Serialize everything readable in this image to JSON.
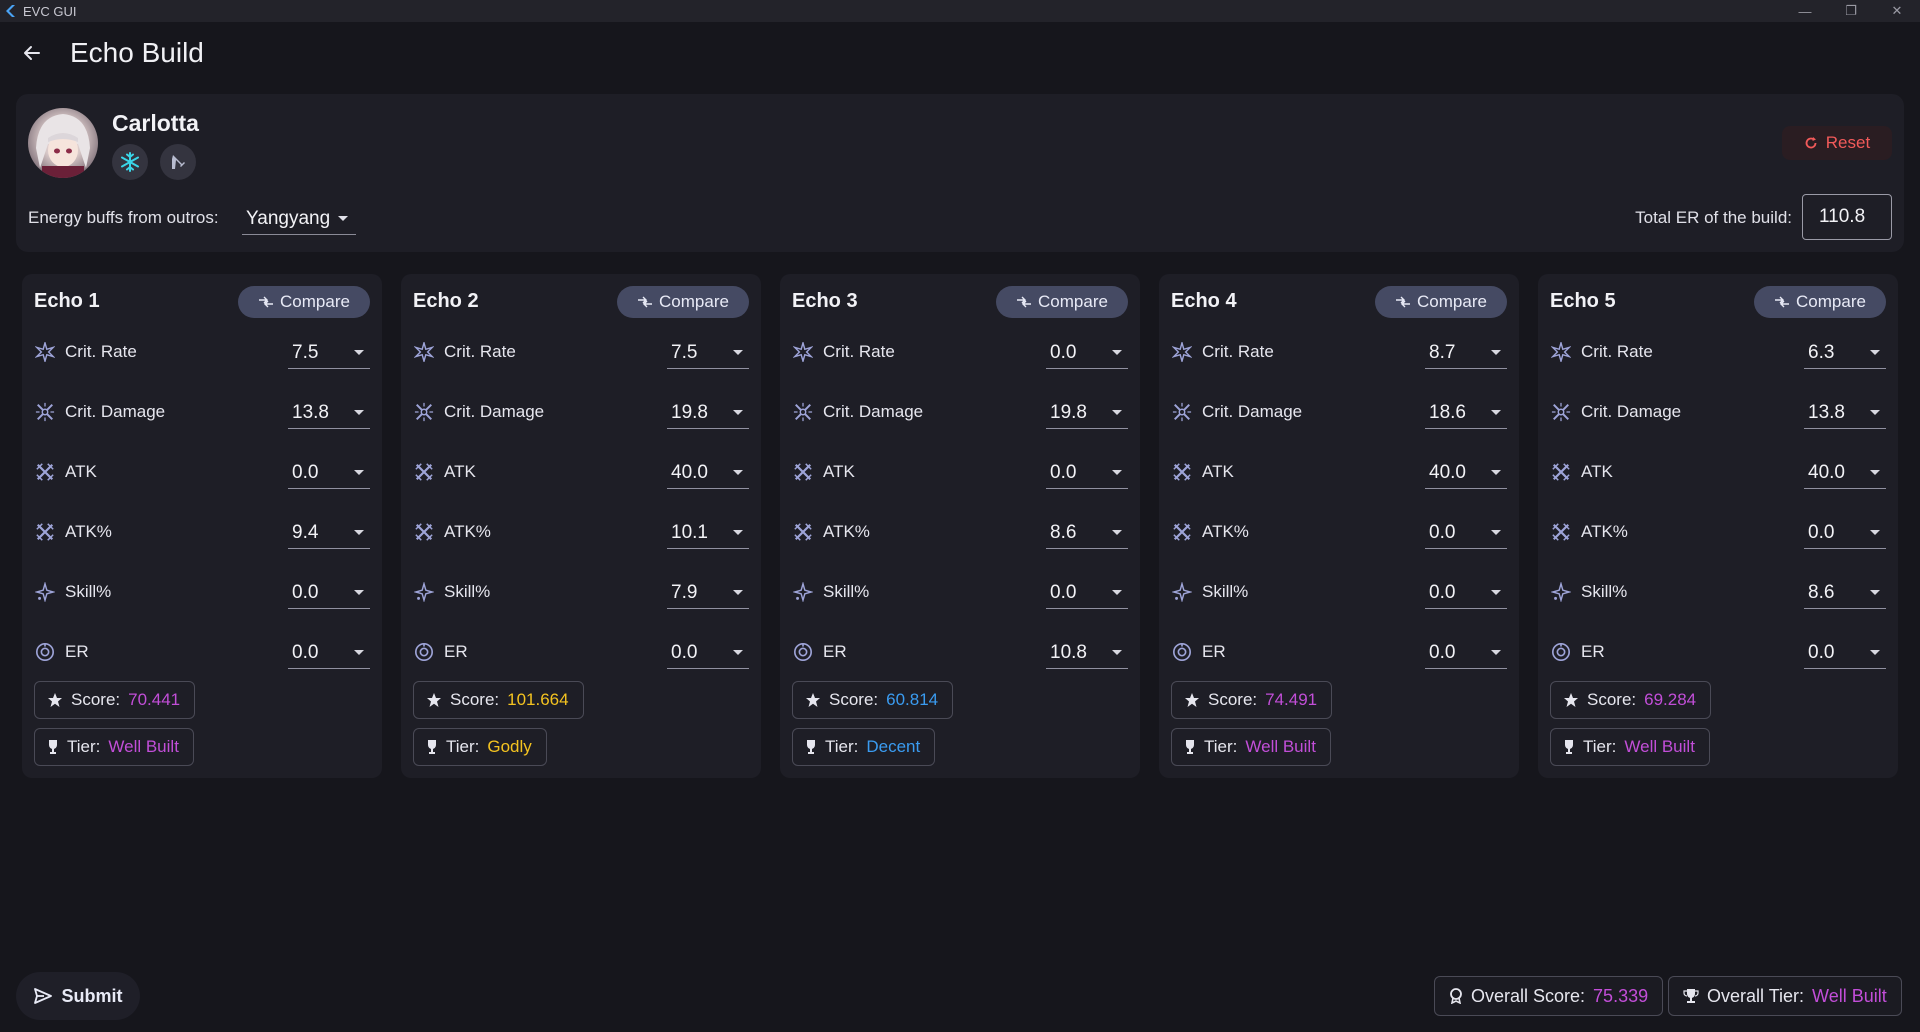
{
  "window": {
    "title": "EVC GUI",
    "controls": {
      "minimize": "—",
      "restore": "❐",
      "close": "✕"
    }
  },
  "header": {
    "title": "Echo Build"
  },
  "character": {
    "name": "Carlotta",
    "element_badge": "snowflake-icon",
    "weapon_badge": "pistol-icon",
    "reset_label": "Reset",
    "outro_label": "Energy buffs from outros:",
    "outro_value": "Yangyang",
    "er_label": "Total ER of the build:",
    "er_value": "110.8"
  },
  "compare_label": "Compare",
  "score_label": "Score:",
  "tier_label": "Tier:",
  "stat_labels": {
    "crit_rate": "Crit. Rate",
    "crit_damage": "Crit. Damage",
    "atk": "ATK",
    "atk_pct": "ATK%",
    "skill_pct": "Skill%",
    "er": "ER"
  },
  "echoes": [
    {
      "title": "Echo 1",
      "crit_rate": "7.5",
      "crit_damage": "13.8",
      "atk": "0.0",
      "atk_pct": "9.4",
      "skill_pct": "0.0",
      "er": "0.0",
      "score": "70.441",
      "tier": "Well Built",
      "tier_color": "#c24ed8"
    },
    {
      "title": "Echo 2",
      "crit_rate": "7.5",
      "crit_damage": "19.8",
      "atk": "40.0",
      "atk_pct": "10.1",
      "skill_pct": "7.9",
      "er": "0.0",
      "score": "101.664",
      "tier": "Godly",
      "tier_color": "#f4c320"
    },
    {
      "title": "Echo 3",
      "crit_rate": "0.0",
      "crit_damage": "19.8",
      "atk": "0.0",
      "atk_pct": "8.6",
      "skill_pct": "0.0",
      "er": "10.8",
      "score": "60.814",
      "tier": "Decent",
      "tier_color": "#3a9bf0"
    },
    {
      "title": "Echo 4",
      "crit_rate": "8.7",
      "crit_damage": "18.6",
      "atk": "40.0",
      "atk_pct": "0.0",
      "skill_pct": "0.0",
      "er": "0.0",
      "score": "74.491",
      "tier": "Well Built",
      "tier_color": "#c24ed8"
    },
    {
      "title": "Echo 5",
      "crit_rate": "6.3",
      "crit_damage": "13.8",
      "atk": "40.0",
      "atk_pct": "0.0",
      "skill_pct": "8.6",
      "er": "0.0",
      "score": "69.284",
      "tier": "Well Built",
      "tier_color": "#c24ed8"
    }
  ],
  "footer": {
    "submit_label": "Submit",
    "overall_score_label": "Overall Score:",
    "overall_score": "75.339",
    "overall_tier_label": "Overall Tier:",
    "overall_tier": "Well Built"
  },
  "colors": {
    "well_built": "#c24ed8",
    "godly": "#f4c320",
    "decent": "#3a9bf0",
    "reset": "#f25a5a"
  }
}
